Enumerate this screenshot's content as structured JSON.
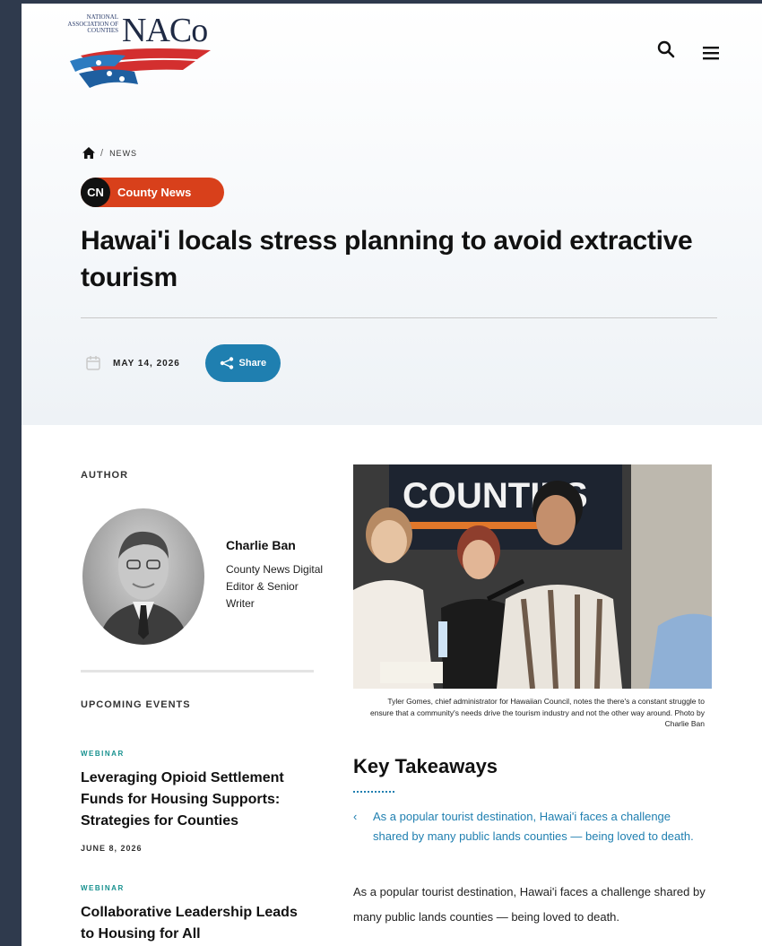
{
  "header": {
    "logo_small_text": "NATIONAL ASSOCIATION of COUNTIES",
    "logo_text": "NACo",
    "search_icon": "search-icon",
    "menu_icon": "hamburger-menu-icon"
  },
  "breadcrumb": {
    "home_icon": "home-icon",
    "separator": "/",
    "current": "NEWS"
  },
  "badge": {
    "short": "CN",
    "label": "County News",
    "color": "#d8401b"
  },
  "article": {
    "title": "Hawai'i locals stress planning to avoid extractive tourism",
    "date": "MAY 14, 2026",
    "share_label": "Share",
    "accent_color": "#1f7fb0"
  },
  "author": {
    "heading": "AUTHOR",
    "name": "Charlie Ban",
    "role": "County News Digital Editor & Senior Writer"
  },
  "events": {
    "heading": "UPCOMING EVENTS",
    "items": [
      {
        "type": "WEBINAR",
        "title": "Leveraging Opioid Settlement Funds for Housing Supports: Strategies for Counties",
        "date": "JUNE 8, 2026"
      },
      {
        "type": "WEBINAR",
        "title": "Collaborative Leadership Leads to Housing for All",
        "date": ""
      }
    ]
  },
  "photo": {
    "banner_text": "COUNTIES",
    "caption": "Tyler Gomes, chief administrator for Hawaiian Council, notes the there's a constant struggle to ensure that a community's needs drive the tourism industry and not the other way around. Photo by Charlie Ban"
  },
  "takeaways": {
    "heading": "Key Takeaways",
    "items": [
      "As a popular tourist destination, Hawai'i faces a challenge shared by many public lands counties — being loved to death."
    ]
  },
  "body": {
    "paragraph1": "As a popular tourist destination, Hawai'i faces a challenge shared by many public lands counties — being loved to death."
  }
}
